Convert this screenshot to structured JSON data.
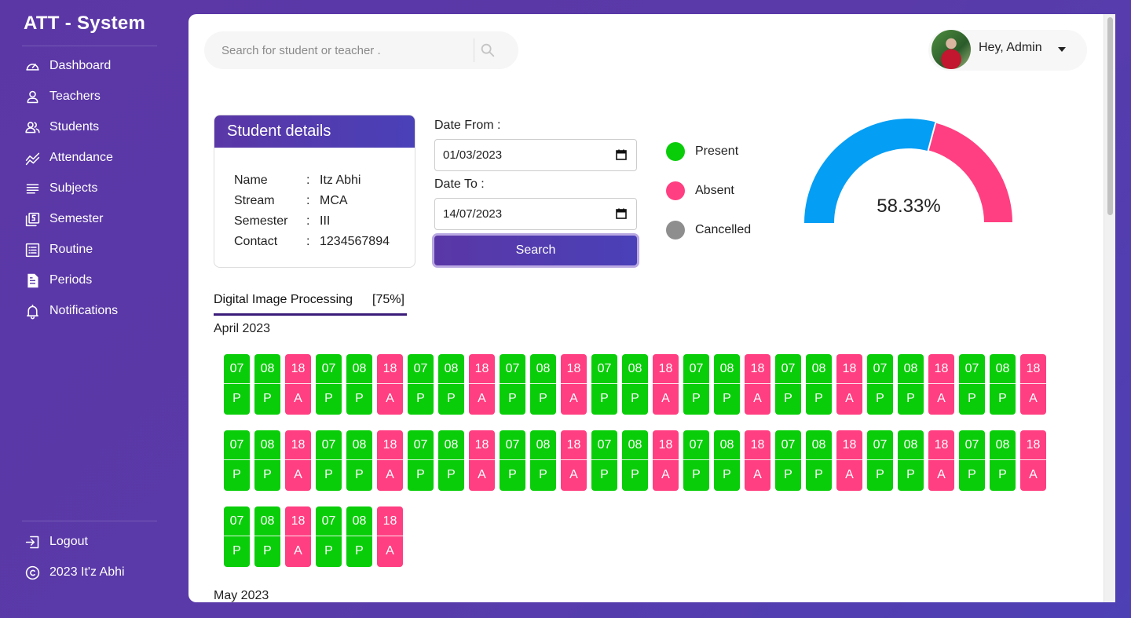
{
  "brand": "ATT - System",
  "colors": {
    "accent": "#5a37a6",
    "present": "#0acd0a",
    "absent": "#ff3f81",
    "cancelled": "#8e8e8e",
    "gauge_blue": "#049ef4"
  },
  "sidebar": {
    "items": [
      {
        "label": "Dashboard",
        "icon": "dashboard-icon"
      },
      {
        "label": "Teachers",
        "icon": "person-icon"
      },
      {
        "label": "Students",
        "icon": "people-icon"
      },
      {
        "label": "Attendance",
        "icon": "trend-icon"
      },
      {
        "label": "Subjects",
        "icon": "list-icon"
      },
      {
        "label": "Semester",
        "icon": "layers-icon"
      },
      {
        "label": "Routine",
        "icon": "routine-icon"
      },
      {
        "label": "Periods",
        "icon": "document-icon"
      },
      {
        "label": "Notifications",
        "icon": "bell-icon"
      }
    ],
    "logout": "Logout",
    "copyright": "2023 It'z Abhi"
  },
  "search": {
    "placeholder": "Search for student or teacher ."
  },
  "user": {
    "greeting": "Hey, Admin"
  },
  "student": {
    "title": "Student details",
    "fields": [
      {
        "key": "Name",
        "value": "Itz Abhi"
      },
      {
        "key": "Stream",
        "value": "MCA"
      },
      {
        "key": "Semester",
        "value": "III"
      },
      {
        "key": "Contact",
        "value": "1234567894"
      }
    ]
  },
  "filter": {
    "from_label": "Date From :",
    "from_value": "01/03/2023",
    "to_label": "Date To :",
    "to_value": "14/07/2023",
    "search_label": "Search"
  },
  "legend": {
    "present": "Present",
    "absent": "Absent",
    "cancelled": "Cancelled"
  },
  "gauge": {
    "value": 58.33,
    "label": "58.33%"
  },
  "subject": {
    "name": "Digital Image Processing",
    "percent": "[75%]"
  },
  "months": [
    {
      "name": "April 2023",
      "rows": [
        [
          [
            "07",
            "P"
          ],
          [
            "08",
            "P"
          ],
          [
            "18",
            "A"
          ],
          [
            "07",
            "P"
          ],
          [
            "08",
            "P"
          ],
          [
            "18",
            "A"
          ],
          [
            "07",
            "P"
          ],
          [
            "08",
            "P"
          ],
          [
            "18",
            "A"
          ],
          [
            "07",
            "P"
          ],
          [
            "08",
            "P"
          ],
          [
            "18",
            "A"
          ],
          [
            "07",
            "P"
          ],
          [
            "08",
            "P"
          ],
          [
            "18",
            "A"
          ],
          [
            "07",
            "P"
          ],
          [
            "08",
            "P"
          ],
          [
            "18",
            "A"
          ],
          [
            "07",
            "P"
          ],
          [
            "08",
            "P"
          ],
          [
            "18",
            "A"
          ],
          [
            "07",
            "P"
          ],
          [
            "08",
            "P"
          ],
          [
            "18",
            "A"
          ],
          [
            "07",
            "P"
          ],
          [
            "08",
            "P"
          ],
          [
            "18",
            "A"
          ]
        ],
        [
          [
            "07",
            "P"
          ],
          [
            "08",
            "P"
          ],
          [
            "18",
            "A"
          ],
          [
            "07",
            "P"
          ],
          [
            "08",
            "P"
          ],
          [
            "18",
            "A"
          ],
          [
            "07",
            "P"
          ],
          [
            "08",
            "P"
          ],
          [
            "18",
            "A"
          ],
          [
            "07",
            "P"
          ],
          [
            "08",
            "P"
          ],
          [
            "18",
            "A"
          ],
          [
            "07",
            "P"
          ],
          [
            "08",
            "P"
          ],
          [
            "18",
            "A"
          ],
          [
            "07",
            "P"
          ],
          [
            "08",
            "P"
          ],
          [
            "18",
            "A"
          ],
          [
            "07",
            "P"
          ],
          [
            "08",
            "P"
          ],
          [
            "18",
            "A"
          ],
          [
            "07",
            "P"
          ],
          [
            "08",
            "P"
          ],
          [
            "18",
            "A"
          ],
          [
            "07",
            "P"
          ],
          [
            "08",
            "P"
          ],
          [
            "18",
            "A"
          ]
        ],
        [
          [
            "07",
            "P"
          ],
          [
            "08",
            "P"
          ],
          [
            "18",
            "A"
          ],
          [
            "07",
            "P"
          ],
          [
            "08",
            "P"
          ],
          [
            "18",
            "A"
          ]
        ]
      ]
    },
    {
      "name": "May 2023",
      "rows": []
    }
  ]
}
